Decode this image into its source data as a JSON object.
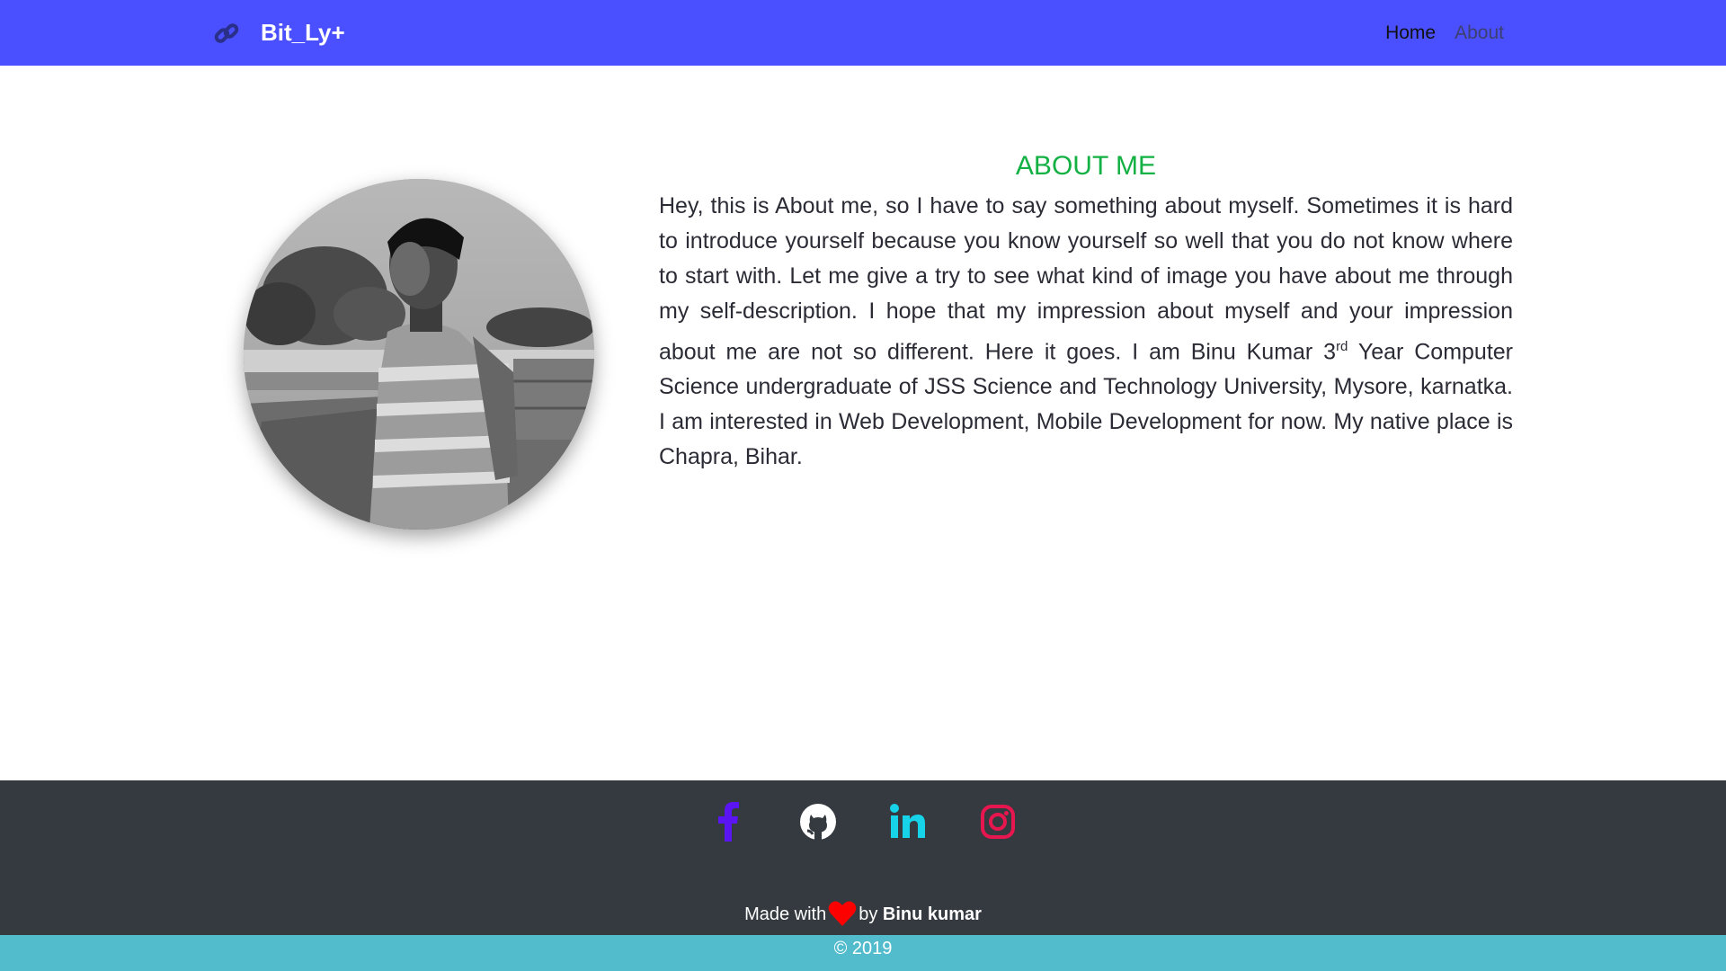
{
  "navbar": {
    "brand": "Bit_Ly+",
    "brand_icon": "link-icon",
    "background": "#4a50ff",
    "links": [
      {
        "label": "Home",
        "active": true
      },
      {
        "label": "About",
        "active": false
      }
    ]
  },
  "about": {
    "title": "ABOUT ME",
    "title_color": "#13b043",
    "profile_photo": "grayscale portrait photo",
    "text_before_sup": "Hey, this is About me, so I have to say something about myself. Sometimes it is hard to introduce yourself because you know yourself so well that you do not know where to start with. Let me give a try to see what kind of image you have about me through my self-description. I hope that my impression about myself and your impression about me are not so different. Here it goes. I am Binu Kumar 3",
    "sup": "rd",
    "text_after_sup": " Year Computer Science undergraduate of JSS Science and Technology University, Mysore, karnatka. I am interested in Web Development, Mobile Development for now. My native place is Chapra, Bihar."
  },
  "footer": {
    "background": "#343a40",
    "social": [
      {
        "icon": "facebook-icon",
        "color": "#5b14f2"
      },
      {
        "icon": "github-icon",
        "color": "#ffffff"
      },
      {
        "icon": "linkedin-icon",
        "color": "#17d3ea"
      },
      {
        "icon": "instagram-icon",
        "color": "#e8164e"
      }
    ],
    "made_with": "Made with",
    "heart_icon": "heart-icon",
    "by": "by",
    "author": "Binu kumar"
  },
  "copyright": {
    "text": "© 2019",
    "background": "#52bccd"
  }
}
